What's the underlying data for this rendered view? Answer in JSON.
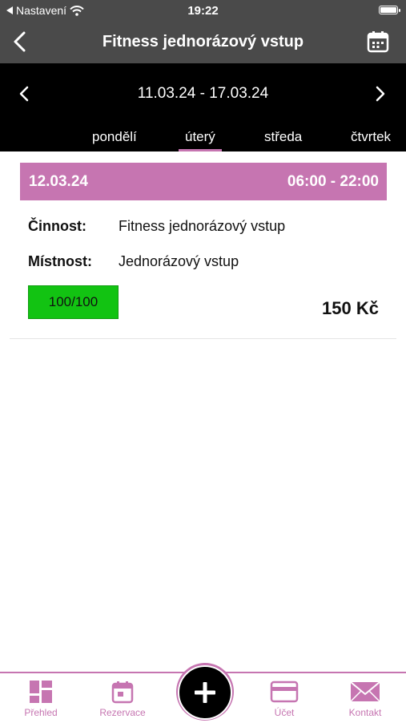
{
  "status_bar": {
    "back_app_label": "Nastavení",
    "time": "19:22"
  },
  "header": {
    "title": "Fitness jednorázový vstup"
  },
  "week": {
    "range": "11.03.24 - 17.03.24",
    "days": [
      "pondělí",
      "úterý",
      "středa",
      "čtvrtek"
    ],
    "active_day": "úterý"
  },
  "event": {
    "date": "12.03.24",
    "hours": "06:00 - 22:00",
    "activity_label": "Činnost:",
    "activity_value": "Fitness jednorázový vstup",
    "room_label": "Místnost:",
    "room_value": "Jednorázový vstup",
    "capacity": "100/100",
    "price": "150 Kč"
  },
  "tabbar": {
    "items": [
      {
        "label": "Přehled",
        "icon": "dashboard-icon"
      },
      {
        "label": "Rezervace",
        "icon": "calendar-icon"
      },
      {
        "label": "Účet",
        "icon": "card-icon"
      },
      {
        "label": "Kontakt",
        "icon": "envelope-icon"
      }
    ],
    "add_icon": "plus-icon"
  },
  "colors": {
    "accent": "#c675b1",
    "header_bg": "#4a4a4a",
    "week_bg": "#000000",
    "capacity_bg": "#12c312"
  }
}
